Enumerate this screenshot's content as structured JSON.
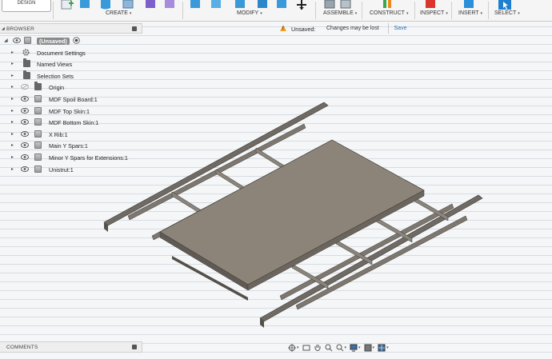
{
  "toolbar": {
    "workspace": "DESIGN",
    "groups": [
      {
        "label": "CREATE",
        "icon": "create-icon"
      },
      {
        "label": "MODIFY",
        "icon": "modify-icon"
      },
      {
        "label": "ASSEMBLE",
        "icon": "assemble-icon"
      },
      {
        "label": "CONSTRUCT",
        "icon": "construct-icon"
      },
      {
        "label": "INSPECT",
        "icon": "inspect-icon"
      },
      {
        "label": "INSERT",
        "icon": "insert-icon"
      },
      {
        "label": "SELECT",
        "icon": "select-icon"
      }
    ],
    "caret": "▾"
  },
  "browser": {
    "title": "BROWSER",
    "root": "(Unsaved)",
    "items": [
      {
        "label": "Document Settings",
        "icon": "gear-icon"
      },
      {
        "label": "Named Views",
        "icon": "folder-icon"
      },
      {
        "label": "Selection Sets",
        "icon": "folder-icon"
      },
      {
        "label": "Origin",
        "icon": "folder-icon"
      },
      {
        "label": "MDF Spoil Board:1",
        "icon": "body-icon"
      },
      {
        "label": "MDF Top Skin:1",
        "icon": "body-icon"
      },
      {
        "label": "MDF Bottom Skin:1",
        "icon": "body-icon"
      },
      {
        "label": "X Rib:1",
        "icon": "body-icon"
      },
      {
        "label": "Main Y Spars:1",
        "icon": "body-icon"
      },
      {
        "label": "Minor Y Spars for Extensions:1",
        "icon": "body-icon"
      },
      {
        "label": "Unistrut:1",
        "icon": "body-icon"
      }
    ]
  },
  "notice": {
    "title": "Unsaved:",
    "message": "Changes may be lost",
    "save_label": "Save"
  },
  "comments": {
    "title": "COMMENTS"
  },
  "colors": {
    "accent_blue": "#2a8fd8",
    "create_green": "#3aa84a",
    "construct_orange": "#e88a1e",
    "inspect_red": "#d9362f",
    "select_blue": "#1f7fcf",
    "model_gray": "#8c8479"
  }
}
